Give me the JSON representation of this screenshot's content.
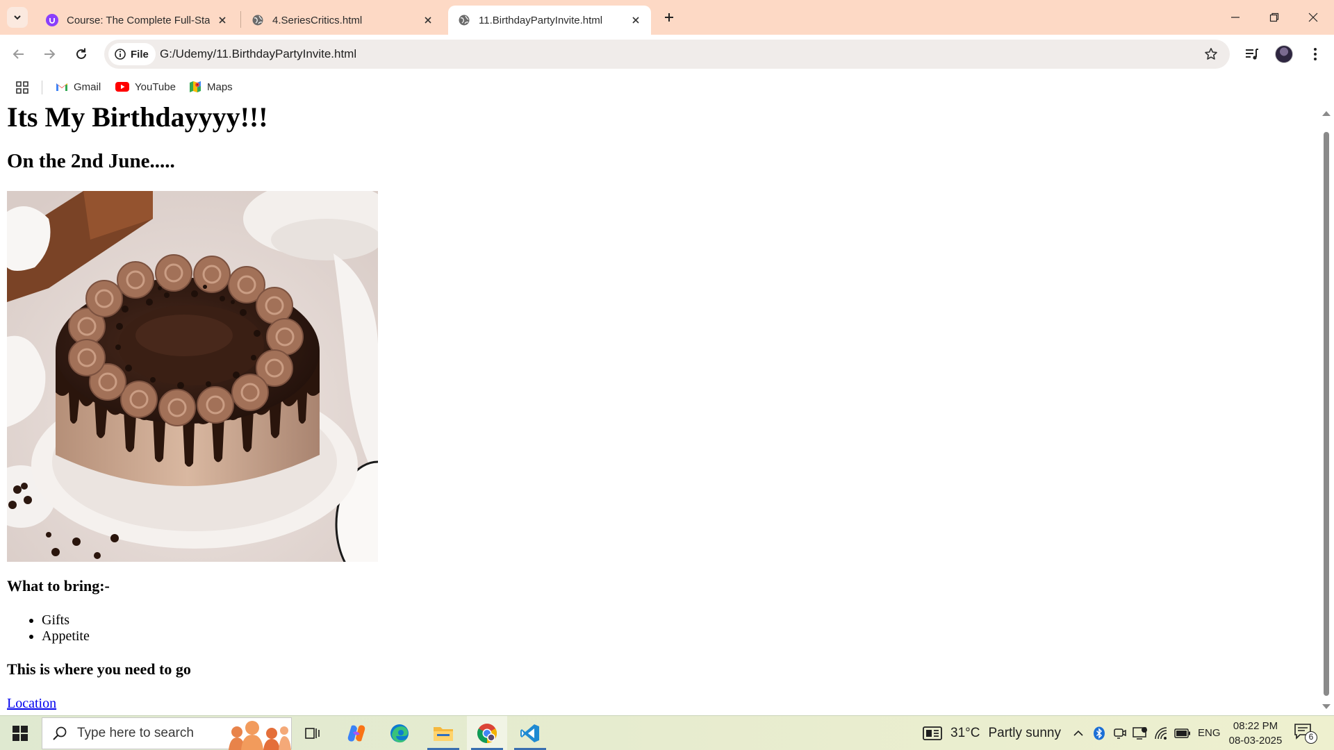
{
  "tabs": [
    {
      "label": "Course: The Complete Full-Stack Web Development Bootcamp",
      "favicon": "udemy-icon",
      "active": false
    },
    {
      "label": "4.SeriesCritics.html",
      "favicon": "globe-icon",
      "active": false
    },
    {
      "label": "11.BirthdayPartyInvite.html",
      "favicon": "globe-icon",
      "active": true
    }
  ],
  "toolbar": {
    "site_chip_label": "File",
    "url": "G:/Udemy/11.BirthdayPartyInvite.html"
  },
  "bookmarks": [
    {
      "label": "Gmail",
      "icon": "gmail-icon"
    },
    {
      "label": "YouTube",
      "icon": "youtube-icon"
    },
    {
      "label": "Maps",
      "icon": "maps-icon"
    }
  ],
  "page": {
    "heading": "Its My Birthdayyyy!!!",
    "subheading": "On the 2nd June.....",
    "image_alt": "chocolate cake",
    "bring_heading": "What to bring:-",
    "bring_items": [
      "Gifts",
      "Appetite"
    ],
    "where_heading": "This is where you need to go",
    "location_link": "Location"
  },
  "taskbar": {
    "search_placeholder": "Type here to search",
    "weather_temp": "31°C",
    "weather_condition": "Partly sunny",
    "language": "ENG",
    "time": "08:22 PM",
    "date": "08-03-2025",
    "notification_count": "6",
    "apps": [
      "task-view",
      "copilot",
      "edge",
      "file-explorer",
      "chrome",
      "vscode"
    ]
  },
  "colors": {
    "titlebar": "#fdd9c5",
    "omnibox": "#f0ecea",
    "link": "#0000ee",
    "taskbar": "#e7eccf"
  }
}
